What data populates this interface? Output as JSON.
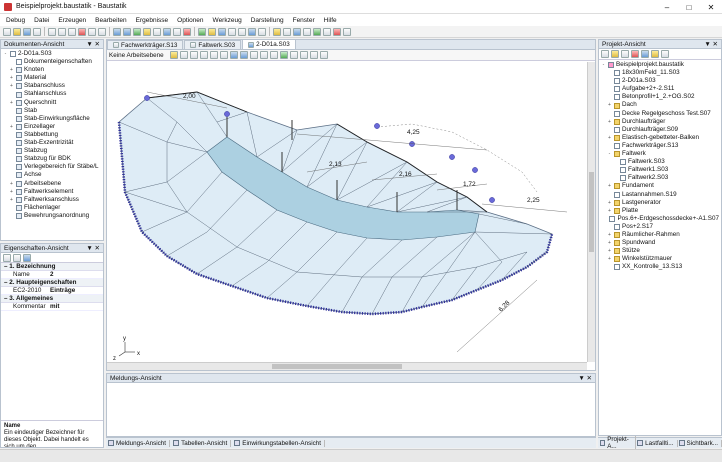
{
  "window": {
    "title": "Beispielprojekt.baustatik - Baustatik"
  },
  "menu": [
    "Debug",
    "Datei",
    "Erzeugen",
    "Bearbeiten",
    "Ergebnisse",
    "Optionen",
    "Werkzeug",
    "Darstellung",
    "Fenster",
    "Hilfe"
  ],
  "doc_panel": {
    "title": "Dokumenten-Ansicht",
    "root": "2-D01a.S03",
    "items": [
      "Dokumenteigenschaften",
      "Knoten",
      "Material",
      "Stabanschluss",
      "Stahlanschluss",
      "Querschnitt",
      "Stab",
      "Stab-Einwirkungsfläche",
      "Einzellager",
      "Stabbettung",
      "Stab-Exzentrizität",
      "Stabzug",
      "Stabzug für BDK",
      "Verlegebereich für Stäbe/L",
      "Achse",
      "Arbeitsebene",
      "Faltwerkselement",
      "Faltwerksanschluss",
      "Flächenlager",
      "Bewehrungsanordnung"
    ]
  },
  "props_panel": {
    "title": "Eigenschaften-Ansicht",
    "sections": [
      {
        "title": "1. Bezeichnung",
        "rows": [
          {
            "k": "Name",
            "v": "2"
          }
        ]
      },
      {
        "title": "2. Haupteigenschaften",
        "rows": [
          {
            "k": "EC2-2010",
            "v": "Einträge"
          }
        ]
      },
      {
        "title": "3. Allgemeines",
        "rows": [
          {
            "k": "Kommentar",
            "v": "mit"
          }
        ]
      }
    ],
    "help_title": "Name",
    "help_text": "Ein eindeutiger Bezeichner für dieses Objekt. Dabei handelt es sich um den..."
  },
  "tabs": [
    "Fachwerkträger.S13",
    "Faltwerk.S03",
    "2-D01a.S03"
  ],
  "drawing_toolbar": {
    "plane": "Keine Arbeitsebene"
  },
  "drawing": {
    "dims": [
      "2,00",
      "4,25",
      "2,13",
      "2,16",
      "1,72",
      "2,25",
      "6,28"
    ],
    "axis_y": "y",
    "axis_x": "x",
    "axis_z": "z"
  },
  "message_panel": {
    "title": "Meldungs-Ansicht"
  },
  "bottom_tabs": [
    "Meldungs-Ansicht",
    "Tabellen-Ansicht",
    "Einwirkungstabellen-Ansicht"
  ],
  "project_panel": {
    "title": "Projekt-Ansicht",
    "root": "Beispielprojekt.baustatik",
    "items": [
      {
        "t": "18x30mFeld_11.S03",
        "ic": "d",
        "lvl": 1
      },
      {
        "t": "2-D01a.S03",
        "ic": "d",
        "lvl": 1
      },
      {
        "t": "Aufgabe+2+-2.S11",
        "ic": "d",
        "lvl": 1
      },
      {
        "t": "Betonprofil+1_2.+OG.S02",
        "ic": "d",
        "lvl": 1
      },
      {
        "t": "Dach",
        "ic": "f",
        "lvl": 1,
        "ex": "+"
      },
      {
        "t": "Decke Regelgeschoss Test.S07",
        "ic": "d",
        "lvl": 1
      },
      {
        "t": "Durchlaufträger",
        "ic": "f",
        "lvl": 1,
        "ex": "+"
      },
      {
        "t": "Durchlaufträger.S09",
        "ic": "d",
        "lvl": 1
      },
      {
        "t": "Elastisch-gebetteter-Balken",
        "ic": "f",
        "lvl": 1,
        "ex": "+"
      },
      {
        "t": "Fachwerkträger.S13",
        "ic": "d",
        "lvl": 1
      },
      {
        "t": "Faltwerk",
        "ic": "f",
        "lvl": 1,
        "ex": "-"
      },
      {
        "t": "Faltwerk.S03",
        "ic": "d",
        "lvl": 2
      },
      {
        "t": "Faltwerk1.S03",
        "ic": "d",
        "lvl": 2
      },
      {
        "t": "Faltwerk2.S03",
        "ic": "d",
        "lvl": 2
      },
      {
        "t": "Fundament",
        "ic": "f",
        "lvl": 1,
        "ex": "+"
      },
      {
        "t": "Lastannahmen.S19",
        "ic": "d",
        "lvl": 1
      },
      {
        "t": "Lastgenerator",
        "ic": "f",
        "lvl": 1,
        "ex": "+"
      },
      {
        "t": "Platte",
        "ic": "f",
        "lvl": 1,
        "ex": "+"
      },
      {
        "t": "Pos.6+-Erdgeschossdecke+-A1.S07",
        "ic": "d",
        "lvl": 1
      },
      {
        "t": "Pos+2.S17",
        "ic": "d",
        "lvl": 1
      },
      {
        "t": "Räumlicher-Rahmen",
        "ic": "f",
        "lvl": 1,
        "ex": "+"
      },
      {
        "t": "Spundwand",
        "ic": "f",
        "lvl": 1,
        "ex": "+"
      },
      {
        "t": "Stütze",
        "ic": "f",
        "lvl": 1,
        "ex": "+"
      },
      {
        "t": "Winkelstützmauer",
        "ic": "f",
        "lvl": 1,
        "ex": "+"
      },
      {
        "t": "XX_Kontrolle_13.S13",
        "ic": "d",
        "lvl": 1
      }
    ]
  },
  "right_bottom_tabs": [
    "Projekt-A...",
    "Lastfallti...",
    "Sichtbark..."
  ]
}
